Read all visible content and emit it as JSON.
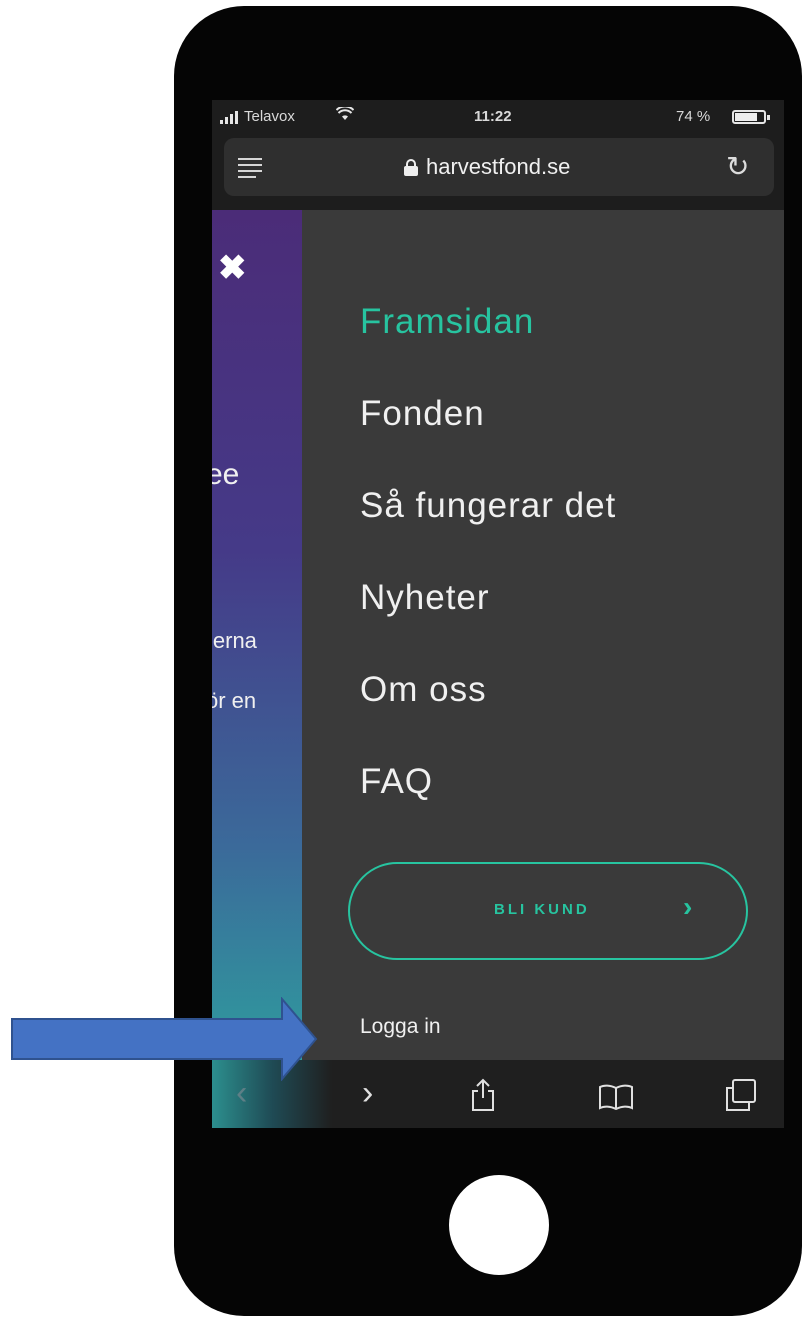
{
  "status_bar": {
    "carrier": "Telavox",
    "time": "11:22",
    "battery_percent": "74 %",
    "battery_level": 0.74,
    "icons": [
      "signal-icon",
      "wifi-icon",
      "battery-icon"
    ]
  },
  "address_bar": {
    "domain": "harvestfond.se",
    "icons": [
      "reader-icon",
      "lock-icon",
      "reload-icon"
    ]
  },
  "page_behind": {
    "fragments": [
      "ee",
      "ierna",
      "ör en"
    ],
    "close_icon": "✖"
  },
  "menu": {
    "items": [
      {
        "label": "Framsidan",
        "active": true
      },
      {
        "label": "Fonden",
        "active": false
      },
      {
        "label": "Så fungerar det",
        "active": false
      },
      {
        "label": "Nyheter",
        "active": false
      },
      {
        "label": "Om oss",
        "active": false
      },
      {
        "label": "FAQ",
        "active": false
      }
    ],
    "cta_label": "BLI KUND",
    "cta_chevron": "›",
    "login_label": "Logga in"
  },
  "toolbar": {
    "back_glyph": "‹",
    "forward_glyph": "›",
    "icons": [
      "back-icon",
      "forward-icon",
      "share-icon",
      "bookmarks-icon",
      "tabs-icon"
    ]
  },
  "colors": {
    "accent": "#27c4a0",
    "menu_background": "#3a3a3a",
    "arrow": "#4472c4"
  }
}
